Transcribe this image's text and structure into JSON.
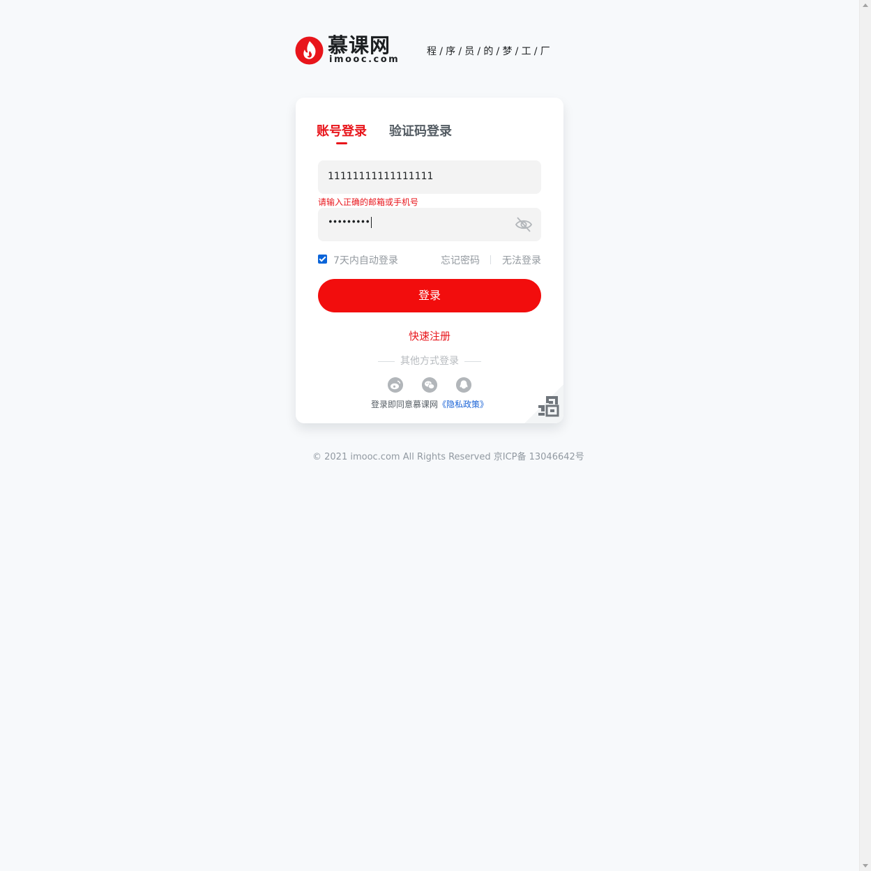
{
  "header": {
    "logo_cn": "慕课网",
    "logo_en": "imooc.com",
    "slogan": "程/序/员/的/梦/工/厂"
  },
  "login": {
    "tabs": [
      {
        "label": "账号登录",
        "active": true
      },
      {
        "label": "验证码登录",
        "active": false
      }
    ],
    "account_value": "11111111111111111",
    "error_message": "请输入正确的邮箱或手机号",
    "password_mask": "•••••••••",
    "remember_label": "7天内自动登录",
    "remember_checked": true,
    "forgot_label": "忘记密码",
    "cant_login_label": "无法登录",
    "submit_label": "登录",
    "register_label": "快速注册",
    "other_methods_label": "其他方式登录",
    "social_icons": [
      "weibo-icon",
      "wechat-icon",
      "qq-icon"
    ],
    "agreement_text": "登录即同意慕课网",
    "privacy_label": "《隐私政策》"
  },
  "footer": {
    "copyright": "© 2021 imooc.com All Rights Reserved 京ICP备 13046642号"
  },
  "colors": {
    "brand_red": "#e8151b",
    "button_red": "#f20d0d",
    "link_blue": "#1a63d6",
    "background": "#f7f9fb"
  }
}
